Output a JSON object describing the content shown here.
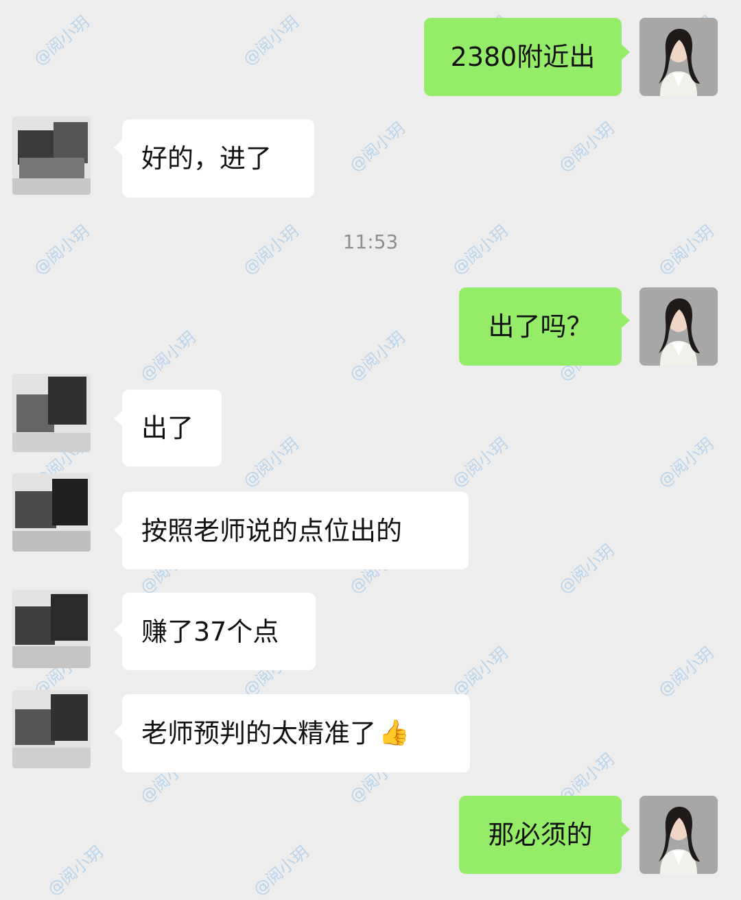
{
  "chat": {
    "timestamp": "11:53",
    "watermark": "@阅小玥",
    "messages": [
      {
        "side": "right",
        "text": "2380附近出"
      },
      {
        "side": "left",
        "text": "好的，进了"
      },
      {
        "side": "right",
        "text": "出了吗？"
      },
      {
        "side": "left",
        "text": "出了"
      },
      {
        "side": "left",
        "text": "按照老师说的点位出的"
      },
      {
        "side": "left",
        "text": "赚了37个点"
      },
      {
        "side": "left",
        "text": "老师预判的太精准了"
      },
      {
        "side": "right",
        "text": "那必须的"
      }
    ],
    "emoji": "👍"
  },
  "colors": {
    "background": "#ededed",
    "incoming_bubble": "#ffffff",
    "outgoing_bubble": "#95ec69",
    "watermark": "#78b4e6"
  }
}
